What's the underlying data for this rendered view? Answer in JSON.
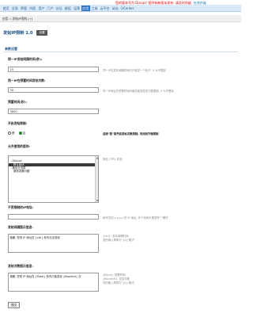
{
  "header": {
    "notice": "您的版本号为 Discuz! 程序有新版本发布: 请及时升级",
    "notice_link": "在线升级",
    "nav": [
      "首页",
      "全局",
      "界面",
      "内容",
      "用户",
      "门户",
      "论坛",
      "群组",
      "运营",
      "应用",
      "工具",
      "云平台",
      "站长",
      "UCenter"
    ],
    "active_nav": "应用"
  },
  "breadcrumb": "应用 » 发帖IP限制 [+]",
  "plugin": {
    "title": "发帖IP限制 1.0",
    "back_label": "设置"
  },
  "section_title": "参数设置",
  "fields": [
    {
      "label": "同一IP发帖间隔时间(秒):",
      "value": "15",
      "tip": "同一IP在发帖间隔时间内只能发一个帖子, 0 为不限制"
    },
    {
      "label": "同一IP在预置时间发帖次数:",
      "value": "30",
      "tip": "同一IP地址在预置时间内最多能发帖的次数限制, 0 为不限制"
    },
    {
      "label": "预置时间(秒):",
      "value": "3600"
    }
  ],
  "open_filter": {
    "label": "开启发帖限制:",
    "options": [
      "是",
      "否"
    ],
    "selected": "否",
    "tip": "选择\"是\"将开启发帖次数限制, 关闭则不做限制"
  },
  "forums": {
    "label": "允许使用的版块:",
    "options": [
      {
        "text": "",
        "indent": false,
        "selected": false
      },
      {
        "text": "--Discuz!",
        "indent": false,
        "selected": false
      },
      {
        "text": "默认版块",
        "indent": true,
        "selected": true
      },
      {
        "text": "--微信交流群",
        "indent": false,
        "selected": false
      },
      {
        "text": "微信设置问题",
        "indent": true,
        "selected": false
      }
    ],
    "tip": "按住 CTRL 多选"
  },
  "exclude_ip": {
    "label": "不受限制的IP地址:",
    "value": "",
    "tip": "填写形如 x.x.x.x 的 IP 地址, 多个请用半角逗号\",\"隔开"
  },
  "interval_msg": {
    "label": "发帖间隔提示信息:",
    "value": "抱歉, 您的 IP 地址在 {ctrl} 秒内无法发帖",
    "tip": "{ctrl}: 发帖间隔时间\n您的输入帮助与\"{s}\"格式"
  },
  "count_msg": {
    "label": "发帖次数提示信息:",
    "value": "抱歉, 您的 IP 地址在 {flood} 秒内只能发帖 {floodctrl} 次",
    "tip": "{flood}: 预置时间\n{floodctrl}: 发帖次数\n您的输入帮助与\"{s}\"格式"
  },
  "submit_label": "提交"
}
